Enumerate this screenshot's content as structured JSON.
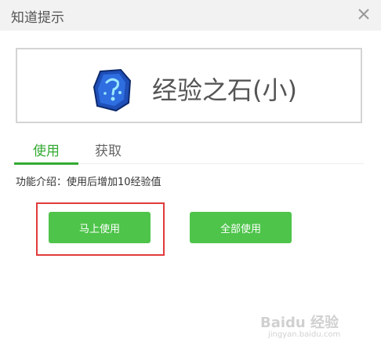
{
  "window": {
    "title": "知道提示",
    "close_icon": "close-icon"
  },
  "item": {
    "name": "经验之石(小)",
    "icon": "blue-rune-stone-icon"
  },
  "tabs": [
    {
      "label": "使用",
      "active": true
    },
    {
      "label": "获取",
      "active": false
    }
  ],
  "description": "功能介绍：使用后增加10经验值",
  "buttons": {
    "use_now": "马上使用",
    "use_all": "全部使用"
  },
  "watermark": {
    "logo": "Baidu 经验",
    "url": "jingyan.baidu.com"
  },
  "colors": {
    "accent_green": "#4ec44a",
    "tab_green": "#33aa33",
    "highlight_red": "#e03b3b"
  }
}
